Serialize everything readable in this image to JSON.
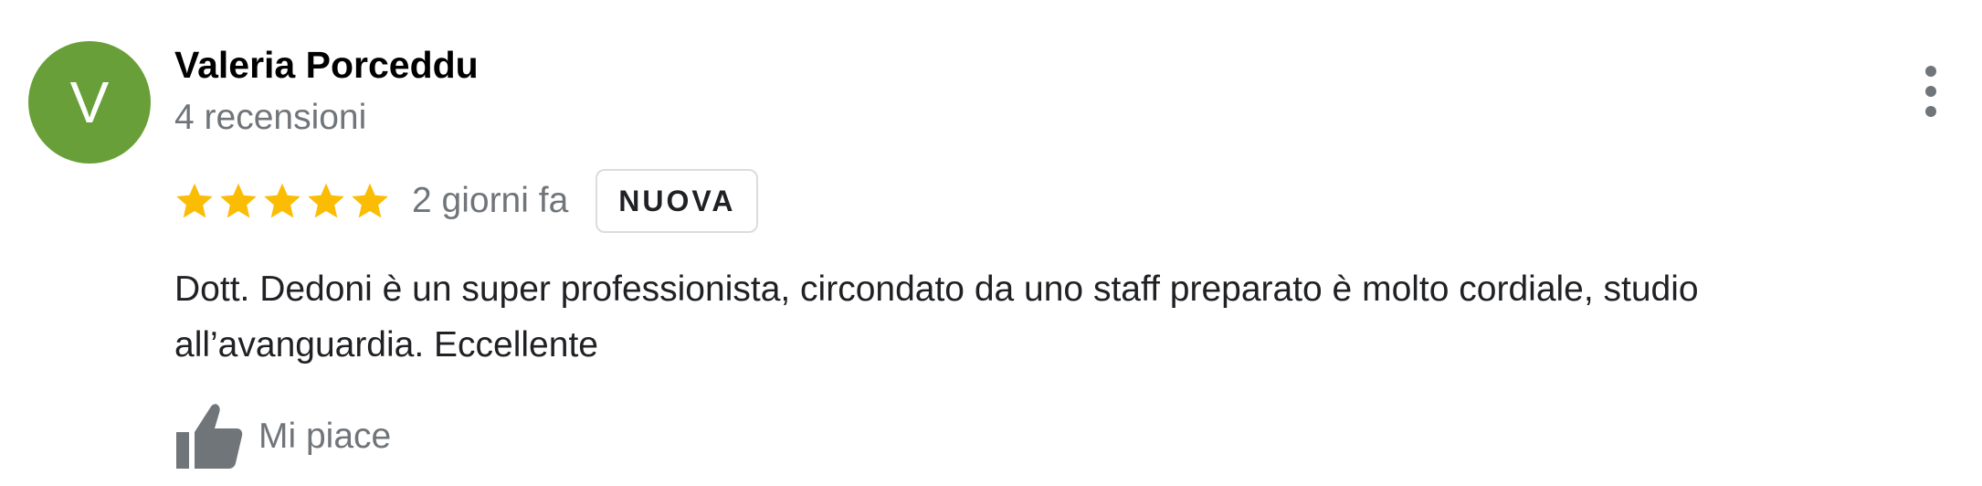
{
  "review": {
    "avatar": {
      "initial": "V",
      "color": "#689f38"
    },
    "author_name": "Valeria Porceddu",
    "review_count": "4 recensioni",
    "rating": 5,
    "rating_max": 5,
    "star_color": "#fbbc04",
    "date": "2 giorni fa",
    "badge": "NUOVA",
    "text_line1": "Dott. Dedoni è un super professionista, circondato da uno staff preparato è molto cordiale, studio",
    "text_line2": "all’avanguardia. Eccellente",
    "like_label": "Mi piace",
    "icons": {
      "more": "more-vert-icon",
      "like": "thumb-up-icon",
      "star": "star-icon"
    }
  }
}
